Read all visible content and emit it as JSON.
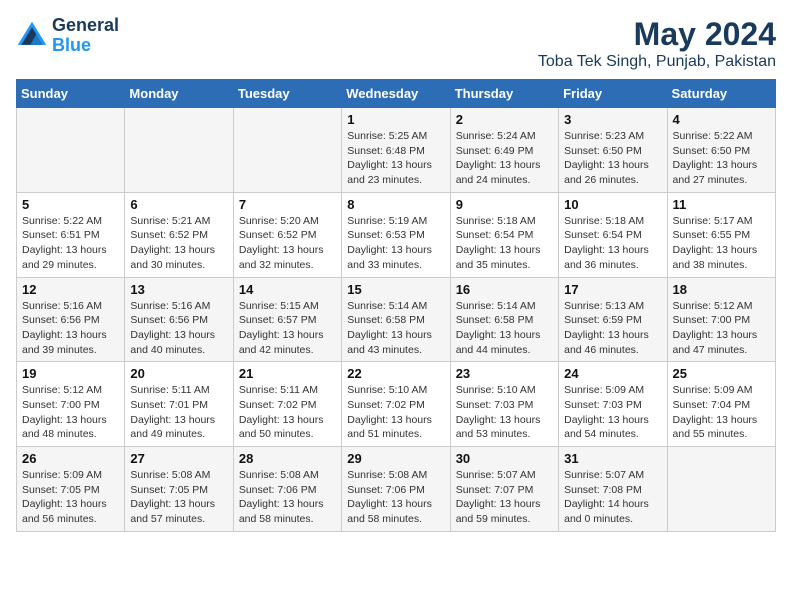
{
  "header": {
    "logo_line1": "General",
    "logo_line2": "Blue",
    "title": "May 2024",
    "subtitle": "Toba Tek Singh, Punjab, Pakistan"
  },
  "days_of_week": [
    "Sunday",
    "Monday",
    "Tuesday",
    "Wednesday",
    "Thursday",
    "Friday",
    "Saturday"
  ],
  "weeks": [
    [
      {
        "day": "",
        "info": ""
      },
      {
        "day": "",
        "info": ""
      },
      {
        "day": "",
        "info": ""
      },
      {
        "day": "1",
        "info": "Sunrise: 5:25 AM\nSunset: 6:48 PM\nDaylight: 13 hours\nand 23 minutes."
      },
      {
        "day": "2",
        "info": "Sunrise: 5:24 AM\nSunset: 6:49 PM\nDaylight: 13 hours\nand 24 minutes."
      },
      {
        "day": "3",
        "info": "Sunrise: 5:23 AM\nSunset: 6:50 PM\nDaylight: 13 hours\nand 26 minutes."
      },
      {
        "day": "4",
        "info": "Sunrise: 5:22 AM\nSunset: 6:50 PM\nDaylight: 13 hours\nand 27 minutes."
      }
    ],
    [
      {
        "day": "5",
        "info": "Sunrise: 5:22 AM\nSunset: 6:51 PM\nDaylight: 13 hours\nand 29 minutes."
      },
      {
        "day": "6",
        "info": "Sunrise: 5:21 AM\nSunset: 6:52 PM\nDaylight: 13 hours\nand 30 minutes."
      },
      {
        "day": "7",
        "info": "Sunrise: 5:20 AM\nSunset: 6:52 PM\nDaylight: 13 hours\nand 32 minutes."
      },
      {
        "day": "8",
        "info": "Sunrise: 5:19 AM\nSunset: 6:53 PM\nDaylight: 13 hours\nand 33 minutes."
      },
      {
        "day": "9",
        "info": "Sunrise: 5:18 AM\nSunset: 6:54 PM\nDaylight: 13 hours\nand 35 minutes."
      },
      {
        "day": "10",
        "info": "Sunrise: 5:18 AM\nSunset: 6:54 PM\nDaylight: 13 hours\nand 36 minutes."
      },
      {
        "day": "11",
        "info": "Sunrise: 5:17 AM\nSunset: 6:55 PM\nDaylight: 13 hours\nand 38 minutes."
      }
    ],
    [
      {
        "day": "12",
        "info": "Sunrise: 5:16 AM\nSunset: 6:56 PM\nDaylight: 13 hours\nand 39 minutes."
      },
      {
        "day": "13",
        "info": "Sunrise: 5:16 AM\nSunset: 6:56 PM\nDaylight: 13 hours\nand 40 minutes."
      },
      {
        "day": "14",
        "info": "Sunrise: 5:15 AM\nSunset: 6:57 PM\nDaylight: 13 hours\nand 42 minutes."
      },
      {
        "day": "15",
        "info": "Sunrise: 5:14 AM\nSunset: 6:58 PM\nDaylight: 13 hours\nand 43 minutes."
      },
      {
        "day": "16",
        "info": "Sunrise: 5:14 AM\nSunset: 6:58 PM\nDaylight: 13 hours\nand 44 minutes."
      },
      {
        "day": "17",
        "info": "Sunrise: 5:13 AM\nSunset: 6:59 PM\nDaylight: 13 hours\nand 46 minutes."
      },
      {
        "day": "18",
        "info": "Sunrise: 5:12 AM\nSunset: 7:00 PM\nDaylight: 13 hours\nand 47 minutes."
      }
    ],
    [
      {
        "day": "19",
        "info": "Sunrise: 5:12 AM\nSunset: 7:00 PM\nDaylight: 13 hours\nand 48 minutes."
      },
      {
        "day": "20",
        "info": "Sunrise: 5:11 AM\nSunset: 7:01 PM\nDaylight: 13 hours\nand 49 minutes."
      },
      {
        "day": "21",
        "info": "Sunrise: 5:11 AM\nSunset: 7:02 PM\nDaylight: 13 hours\nand 50 minutes."
      },
      {
        "day": "22",
        "info": "Sunrise: 5:10 AM\nSunset: 7:02 PM\nDaylight: 13 hours\nand 51 minutes."
      },
      {
        "day": "23",
        "info": "Sunrise: 5:10 AM\nSunset: 7:03 PM\nDaylight: 13 hours\nand 53 minutes."
      },
      {
        "day": "24",
        "info": "Sunrise: 5:09 AM\nSunset: 7:03 PM\nDaylight: 13 hours\nand 54 minutes."
      },
      {
        "day": "25",
        "info": "Sunrise: 5:09 AM\nSunset: 7:04 PM\nDaylight: 13 hours\nand 55 minutes."
      }
    ],
    [
      {
        "day": "26",
        "info": "Sunrise: 5:09 AM\nSunset: 7:05 PM\nDaylight: 13 hours\nand 56 minutes."
      },
      {
        "day": "27",
        "info": "Sunrise: 5:08 AM\nSunset: 7:05 PM\nDaylight: 13 hours\nand 57 minutes."
      },
      {
        "day": "28",
        "info": "Sunrise: 5:08 AM\nSunset: 7:06 PM\nDaylight: 13 hours\nand 58 minutes."
      },
      {
        "day": "29",
        "info": "Sunrise: 5:08 AM\nSunset: 7:06 PM\nDaylight: 13 hours\nand 58 minutes."
      },
      {
        "day": "30",
        "info": "Sunrise: 5:07 AM\nSunset: 7:07 PM\nDaylight: 13 hours\nand 59 minutes."
      },
      {
        "day": "31",
        "info": "Sunrise: 5:07 AM\nSunset: 7:08 PM\nDaylight: 14 hours\nand 0 minutes."
      },
      {
        "day": "",
        "info": ""
      }
    ]
  ]
}
